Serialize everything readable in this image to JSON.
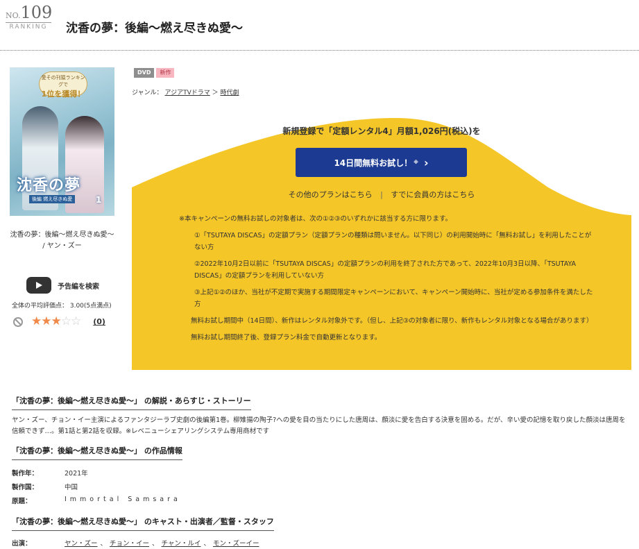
{
  "header": {
    "rank_prefix": "NO.",
    "rank_number": "109",
    "rank_label": "RANKING",
    "title": "沈香の夢：後編〜燃え尽きぬ愛〜"
  },
  "cover": {
    "badge_top": "愛その刊猿ランキングで",
    "badge_main": "1位を獲得！",
    "title": "沈香の夢",
    "subtitle": "後編 燃え尽きぬ愛",
    "volume": "1"
  },
  "item": {
    "caption_line1": "沈香の夢：後編〜燃え尽きぬ愛〜",
    "caption_line2": "/ ヤン・ズー"
  },
  "trailer": {
    "label": "予告編を検索"
  },
  "rating": {
    "average_label": "全体の平均評価点： 3.00(5点満点)",
    "value": 3,
    "max": 5,
    "count": "(0)"
  },
  "tags": {
    "format": "DVD",
    "status": "新作"
  },
  "genre": {
    "prefix": "ジャンル：",
    "primary": "アジアTVドラマ",
    "arrow": "＞",
    "secondary": "時代劇"
  },
  "campaign": {
    "promo_text": "新規登録で「定額レンタル4」月額1,026円(税込)を",
    "button_label": "14日間無料お試し！",
    "button_mark": "※",
    "other_plans": "その他のプランはこちら",
    "separator": "|",
    "members": "すでに会員の方はこちら",
    "note_intro": "※本キャンペーンの無料お試しの対象者は、次の①②③のいずれかに該当する方に限ります。",
    "note1": "①「TSUTAYA DISCAS」の定額プラン（定額プランの種類は問いません。以下同じ）の利用開始時に「無料お試し」を利用したことがない方",
    "note2": "②2022年10月2日以前に「TSUTAYA DISCAS」の定額プランの利用を終了された方であって、2022年10月3日以降、「TSUTAYA DISCAS」の定額プランを利用していない方",
    "note3": "③上記①②のほか、当社が不定期で実施する期間限定キャンペーンにおいて、キャンペーン開始時に、当社が定める参加条件を満たした方",
    "note4": "無料お試し期間中（14日間）、新作はレンタル対象外です。（但し、上記③の対象者に限り、新作もレンタル対象となる場合があります）",
    "note5": "無料お試し期間終了後、登録プラン料金で自動更新となります。",
    "bg_color": "#f5c628",
    "button_color": "#1c3a92"
  },
  "synopsis": {
    "heading": "「沈香の夢：後編〜燃え尽きぬ愛〜」 の解説・あらすじ・ストーリー",
    "text": "ヤン・ズー、チョン・イー主演によるファンタジーラブ史劇の後編第1巻。柳雉揚の陶子?への愛を目の当たりにした唐周は、顔淡に愛を告白する決意を固める。だが、辛い愛の記憶を取り戻した顔淡は唐周を信頼できず…。第1話と第2話を収録。※レベニューシェアリングシステム専用商材です"
  },
  "details": {
    "heading": "「沈香の夢：後編〜燃え尽きぬ愛〜」 の作品情報",
    "year_label": "製作年：",
    "year_value": "2021年",
    "country_label": "製作国：",
    "country_value": "中国",
    "original_label": "原題：",
    "original_value": "Immortal Samsara"
  },
  "cast": {
    "heading": "「沈香の夢：後編〜燃え尽きぬ愛〜」 のキャスト・出演者／監督・スタッフ",
    "label": "出演：",
    "names": [
      "ヤン・ズー",
      "チョン・イー",
      "チャン・ルイ",
      "モン・ズーイー"
    ],
    "sep": "、"
  }
}
